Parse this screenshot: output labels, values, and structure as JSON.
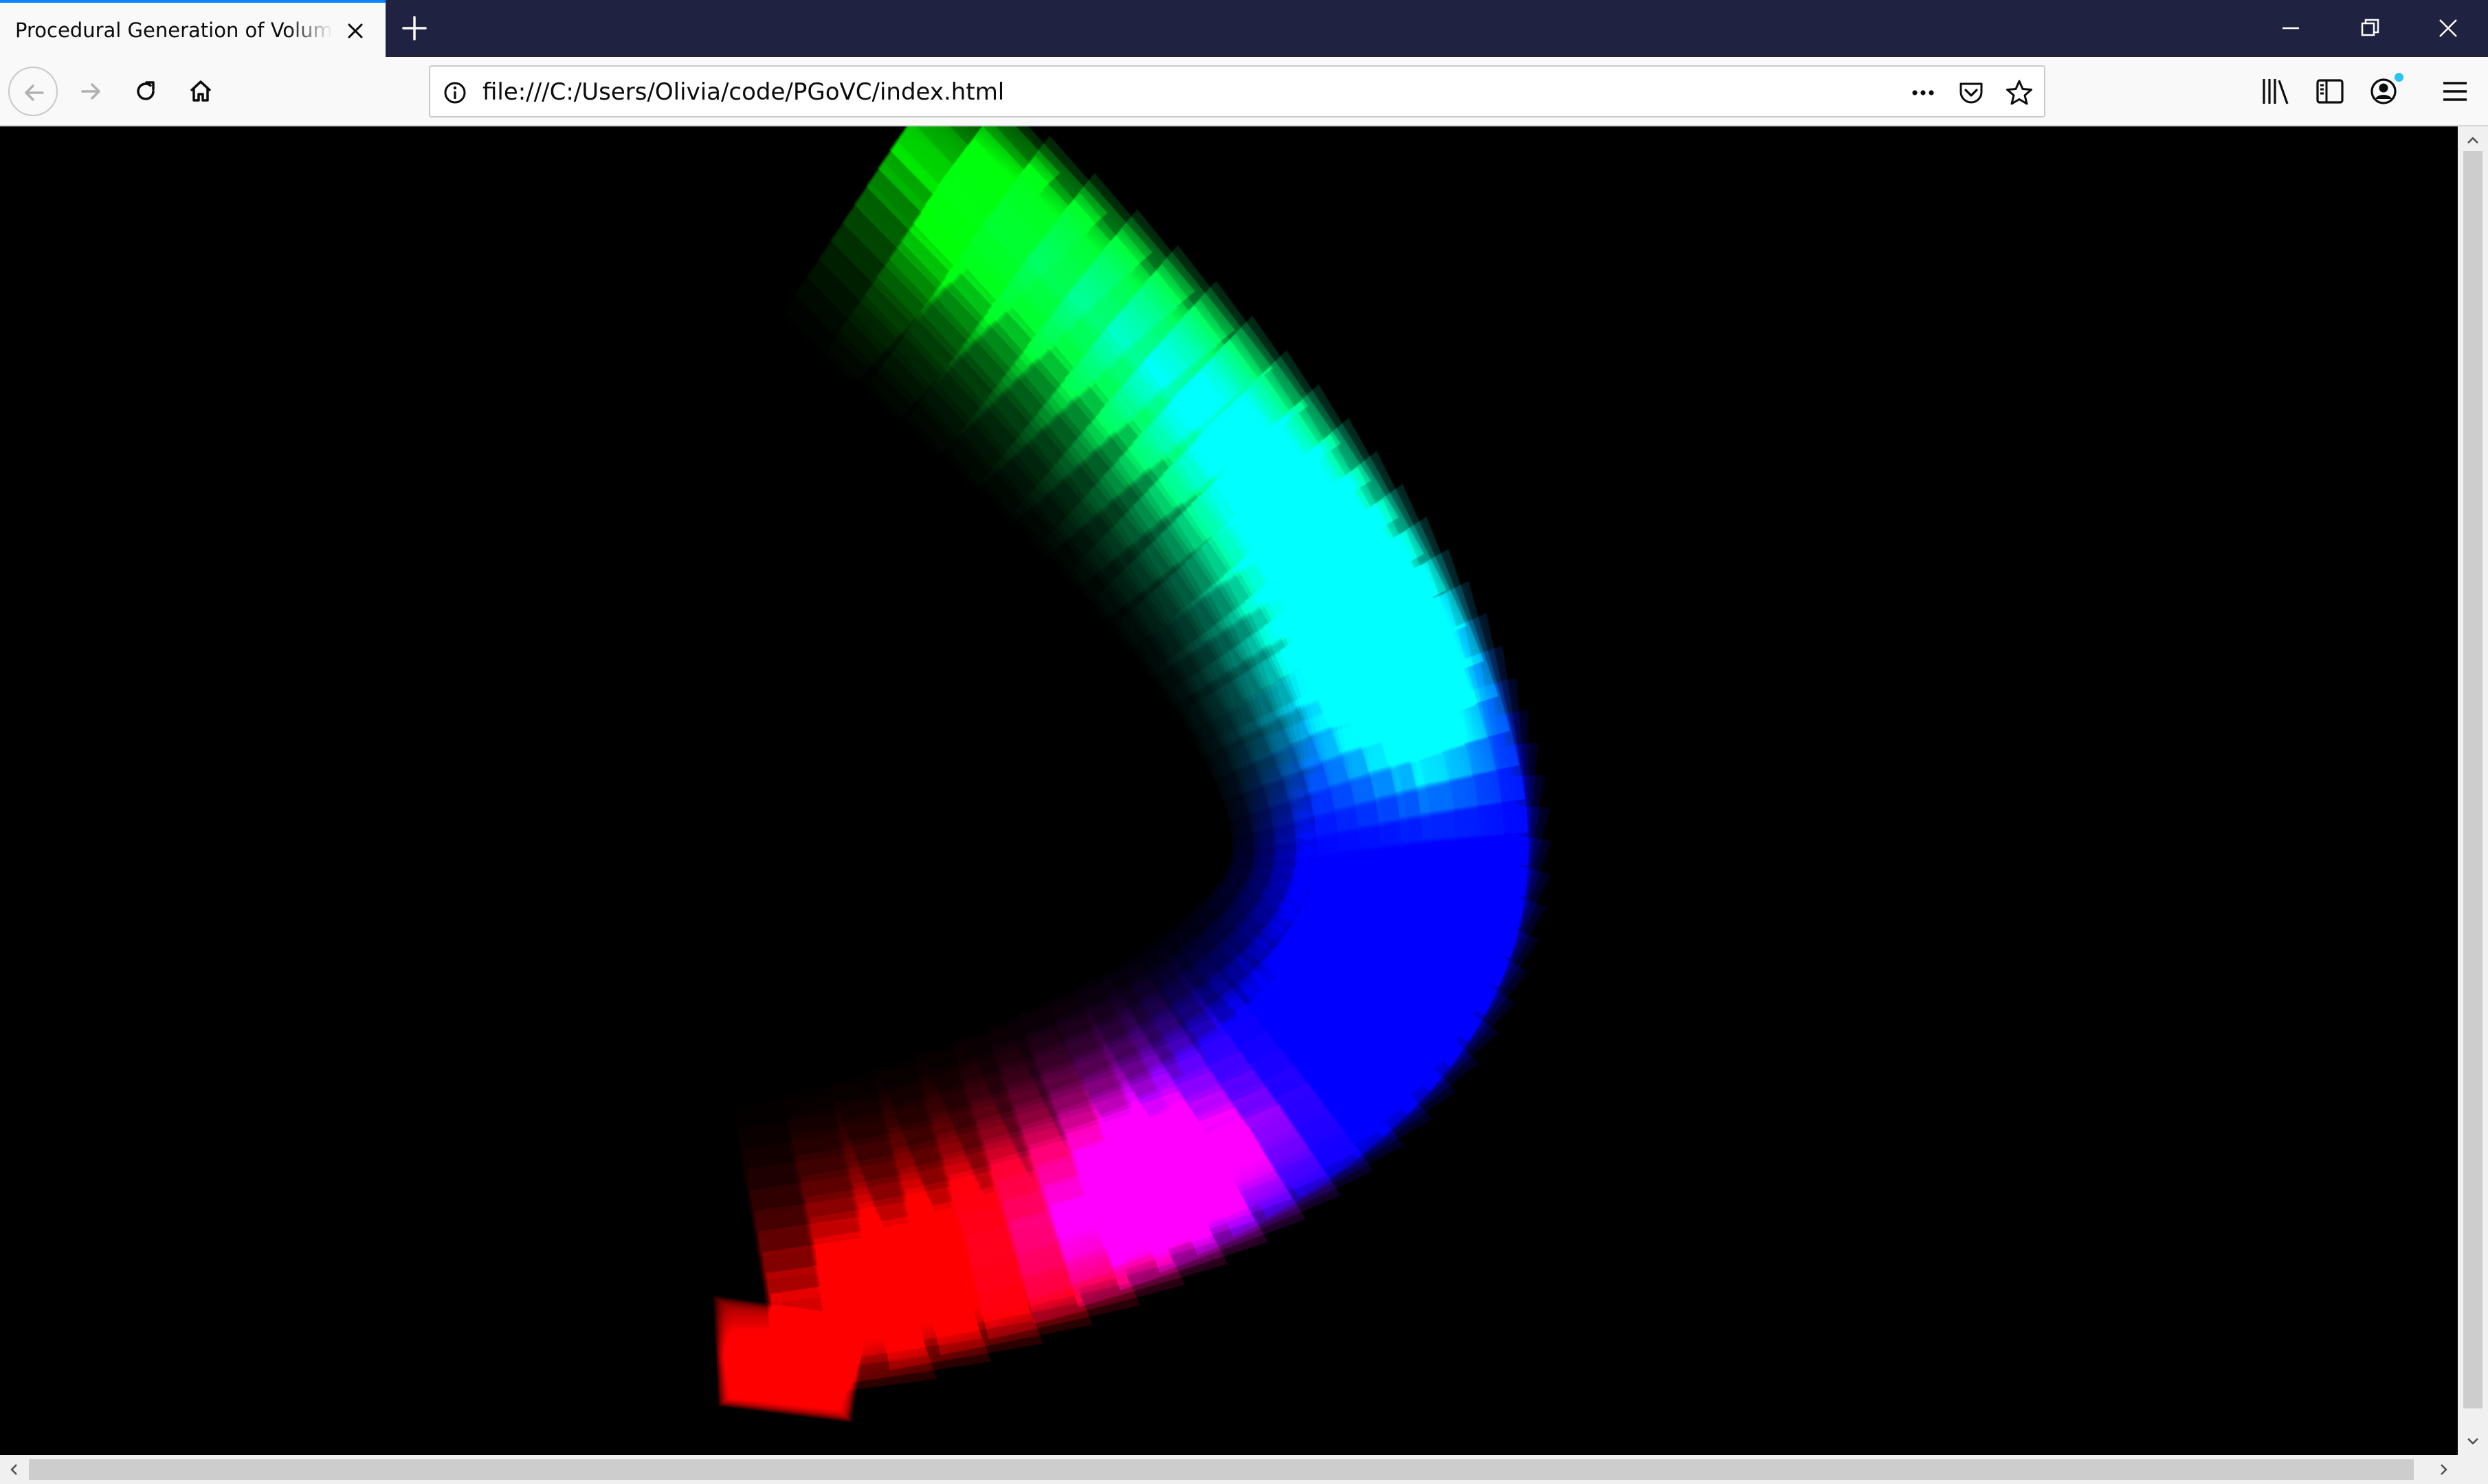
{
  "browser": {
    "tab": {
      "title": "Procedural Generation of Volumetric Clouds"
    },
    "url": "file:///C:/Users/Olivia/code/PGoVC/index.html"
  },
  "colors": {
    "tab_strip": "#1f2341",
    "tab_active_accent": "#0a84ff",
    "toolbar": "#f9f9fa",
    "notification_dot": "#2ac3f5",
    "canvas_background": "#000000",
    "volume_gradient": [
      "#ff0000",
      "#ff00ff",
      "#0000ff",
      "#00ffff",
      "#00ff00"
    ]
  },
  "icons": {
    "tab": [
      "close-icon",
      "plus-icon"
    ],
    "window": [
      "minimize-icon",
      "restore-icon",
      "close-icon"
    ],
    "nav": [
      "arrow-left-icon",
      "arrow-right-icon",
      "reload-icon",
      "home-icon"
    ],
    "urlbar": [
      "info-icon",
      "more-icon",
      "pocket-icon",
      "star-icon"
    ],
    "toolbar": [
      "library-icon",
      "sidebar-icon",
      "account-icon",
      "menu-icon"
    ]
  }
}
